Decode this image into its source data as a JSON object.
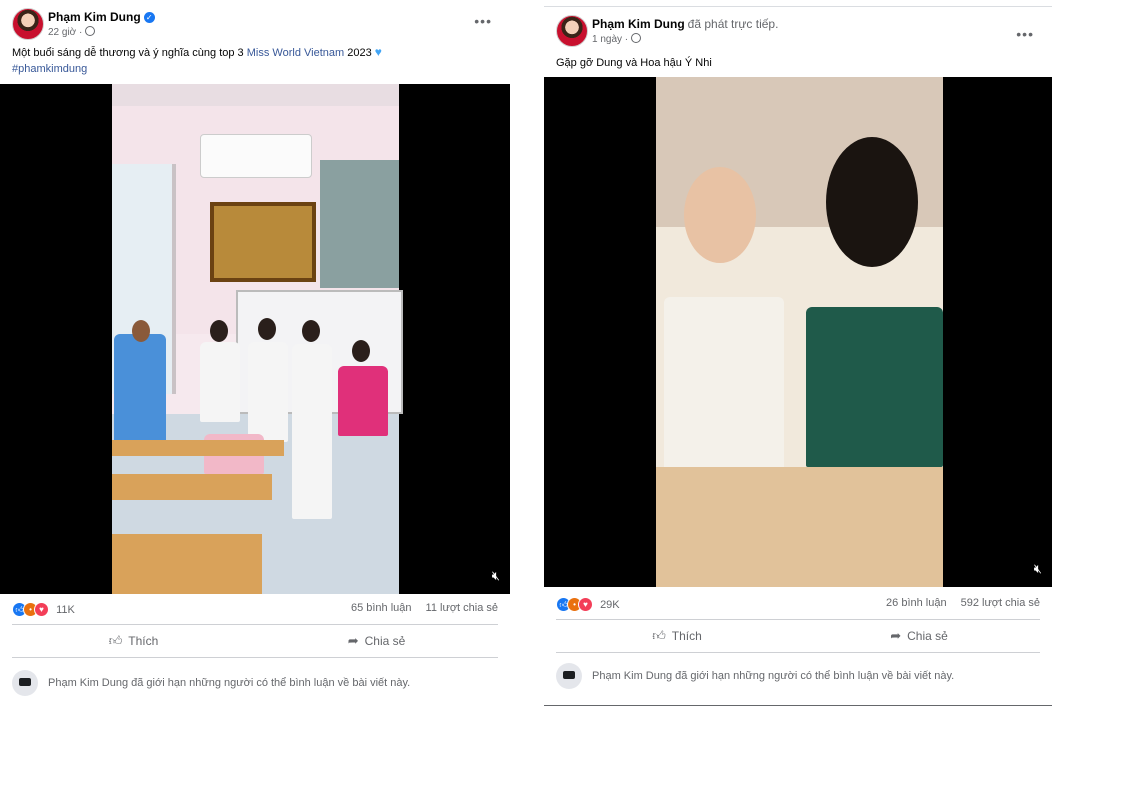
{
  "posts": [
    {
      "author": "Phạm Kim Dung",
      "verified": true,
      "time": "22 giờ ·",
      "caption_prefix": "Một buổi sáng dễ thương và ý nghĩa cùng top 3",
      "caption_link": "Miss World Vietnam",
      "caption_suffix": "2023",
      "hashtag": "#phamkimdung",
      "reaction_count": "11K",
      "comments": "65 bình luận",
      "shares": "11 lượt chia sẻ",
      "like_label": "Thích",
      "share_label": "Chia sẻ",
      "comment_limit": "Phạm Kim Dung đã giới hạn những người có thể bình luận về bài viết này."
    },
    {
      "author": "Phạm Kim Dung",
      "action": "đã phát trực tiếp.",
      "time": "1 ngày ·",
      "caption": "Gặp gỡ Dung và Hoa hậu Ý Nhi",
      "reaction_count": "29K",
      "comments": "26 bình luận",
      "shares": "592 lượt chia sẻ",
      "like_label": "Thích",
      "share_label": "Chia sẻ",
      "comment_limit": "Phạm Kim Dung đã giới hạn những người có thể bình luận về bài viết này."
    }
  ],
  "icons": {
    "more": "more-horizontal-icon",
    "globe": "globe-icon",
    "like": "thumbs-up-icon",
    "share": "share-arrow-icon",
    "mute": "speaker-muted-icon",
    "heart": "blue-heart-icon"
  },
  "colors": {
    "brand_blue": "#1877f2",
    "link": "#385898",
    "secondary_text": "#65676b"
  }
}
